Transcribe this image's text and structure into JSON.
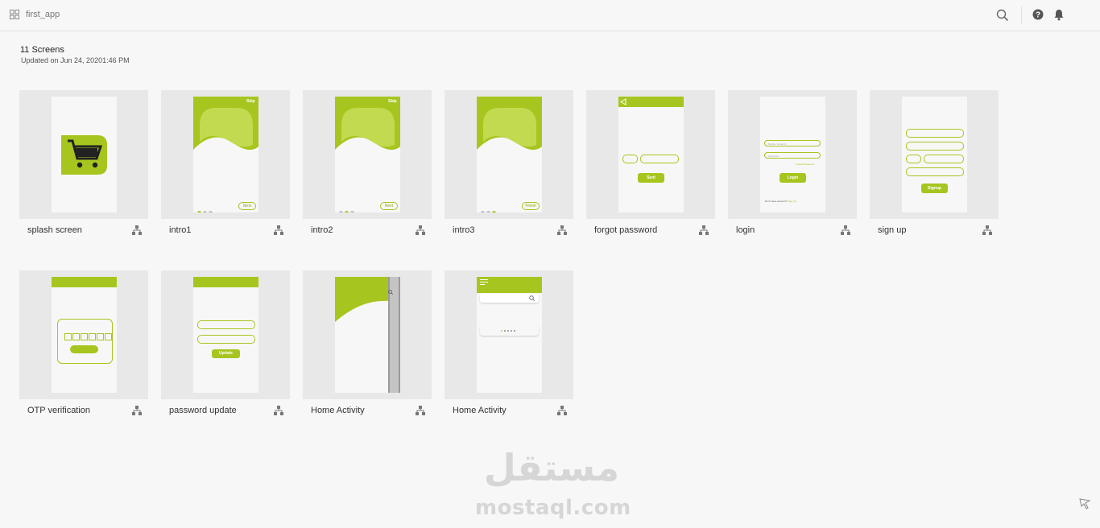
{
  "header": {
    "app_name": "first_app",
    "icons": [
      "grid-icon",
      "search-icon",
      "help-icon",
      "bell-icon"
    ]
  },
  "summary": {
    "screens_count": "11 Screens",
    "updated": "Updated on Jun 24, 20201:46 PM"
  },
  "accent_color": "#a6c61f",
  "screens": [
    {
      "label": "splash screen"
    },
    {
      "label": "intro1",
      "skip": "Skip",
      "button": "Next"
    },
    {
      "label": "intro2",
      "skip": "Skip",
      "button": "Next"
    },
    {
      "label": "intro3",
      "button": "Finish"
    },
    {
      "label": "forgot password",
      "button": "Sent"
    },
    {
      "label": "login",
      "button": "Login",
      "field1": "Mobile / Email Id",
      "field2": "Password",
      "forgot": "Forgot Password",
      "footer": "Don't have account?",
      "footer_link": "Sign Up"
    },
    {
      "label": "sign up",
      "button": "Signup"
    },
    {
      "label": "OTP verification"
    },
    {
      "label": "password update",
      "button": "Update"
    },
    {
      "label": "Home Activity"
    },
    {
      "label": "Home Activity"
    }
  ],
  "watermark": {
    "arabic": "مستقل",
    "latin": "mostaql.com"
  }
}
